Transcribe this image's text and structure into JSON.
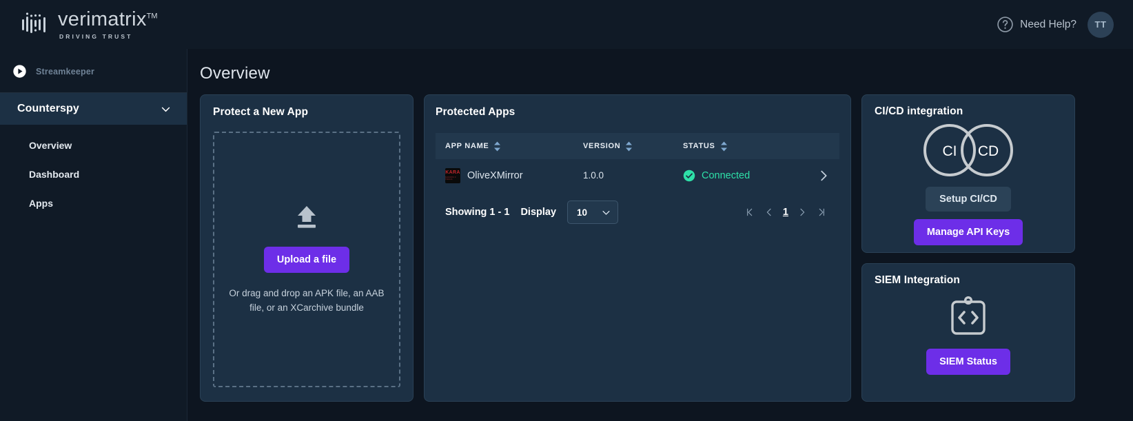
{
  "header": {
    "brand_name": "verimatrix",
    "brand_tm": "TM",
    "brand_tagline": "DRIVING TRUST",
    "help_label": "Need Help?",
    "help_icon": "question-circle-icon",
    "avatar_initials": "TT"
  },
  "sidebar": {
    "product_label": "Streamkeeper",
    "product_icon": "play-circle-icon",
    "group": {
      "label": "Counterspy",
      "chevron_icon": "chevron-down-icon",
      "items": [
        {
          "label": "Overview"
        },
        {
          "label": "Dashboard"
        },
        {
          "label": "Apps"
        }
      ]
    }
  },
  "main": {
    "page_title": "Overview",
    "protect": {
      "title": "Protect a New App",
      "upload_icon": "upload-arrow-icon",
      "upload_button": "Upload a file",
      "hint": "Or drag and drop an APK file, an AAB file, or an XCarchive bundle"
    },
    "apps": {
      "title": "Protected Apps",
      "columns": [
        {
          "label": "APP NAME",
          "sort_icon": "sort-arrows-icon"
        },
        {
          "label": "VERSION",
          "sort_icon": "sort-arrows-icon"
        },
        {
          "label": "STATUS",
          "sort_icon": "sort-arrows-icon"
        }
      ],
      "rows": [
        {
          "icon": "app-thumbnail-icon",
          "icon_text_main": "KARA",
          "icon_text_sub": "KARATE X TOOLS",
          "name": "OliveXMirror",
          "version": "1.0.0",
          "status": "Connected",
          "status_icon": "check-circle-icon",
          "row_chevron": "chevron-right-icon"
        }
      ],
      "footer": {
        "showing": "Showing 1 - 1",
        "display_label": "Display",
        "page_size": "10",
        "page_size_chevron": "chevron-down-icon",
        "first_icon": "first-page-icon",
        "prev_icon": "prev-page-icon",
        "current_page": "1",
        "next_icon": "next-page-icon",
        "last_icon": "last-page-icon"
      }
    },
    "cicd": {
      "title": "CI/CD integration",
      "art_icon": "infinity-cicd-icon",
      "circle_left_label": "CI",
      "circle_right_label": "CD",
      "setup_button": "Setup CI/CD",
      "manage_button": "Manage API Keys"
    },
    "siem": {
      "title": "SIEM Integration",
      "art_icon": "clipboard-code-icon",
      "status_button": "SIEM Status"
    }
  },
  "colors": {
    "accent_purple": "#6d2ee8",
    "status_green": "#2ee0a8",
    "panel_bg": "#1c3044",
    "page_bg": "#0d1520",
    "chrome_bg": "#101a26"
  }
}
